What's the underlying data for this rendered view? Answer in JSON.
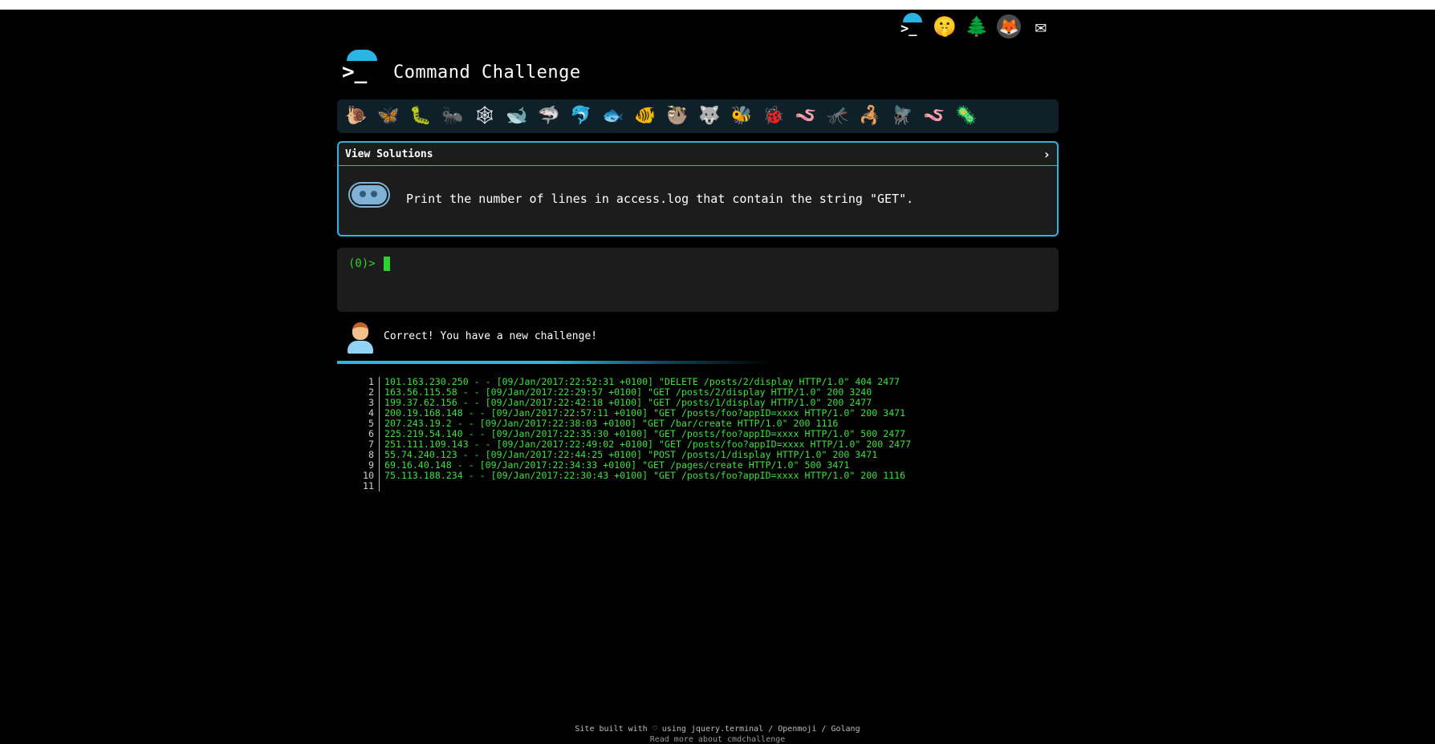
{
  "app": {
    "title": "Command Challenge",
    "top_icons": [
      "terminal-icon",
      "thinking-face-icon",
      "tree-icon",
      "gitlab-icon",
      "envelope-icon"
    ]
  },
  "critters": [
    {
      "name": "snail",
      "glyph": "🐌"
    },
    {
      "name": "butterfly",
      "glyph": "🦋"
    },
    {
      "name": "caterpillar",
      "glyph": "🐛"
    },
    {
      "name": "ant",
      "glyph": "🐜"
    },
    {
      "name": "spider-web",
      "glyph": "🕸"
    },
    {
      "name": "whale",
      "glyph": "🐋"
    },
    {
      "name": "shark",
      "glyph": "🦈"
    },
    {
      "name": "dolphin",
      "glyph": "🐬"
    },
    {
      "name": "fish",
      "glyph": "🐟"
    },
    {
      "name": "tropical-fish",
      "glyph": "🐠"
    },
    {
      "name": "sloth",
      "glyph": "🦥"
    },
    {
      "name": "wolf",
      "glyph": "🐺"
    },
    {
      "name": "bee",
      "glyph": "🐝"
    },
    {
      "name": "ladybug",
      "glyph": "🐞"
    },
    {
      "name": "worm",
      "glyph": "🪱"
    },
    {
      "name": "mosquito",
      "glyph": "🦟"
    },
    {
      "name": "scorpion",
      "glyph": "🦂"
    },
    {
      "name": "fly",
      "glyph": "🪰"
    },
    {
      "name": "worm-pink",
      "glyph": "🪱"
    },
    {
      "name": "microbe",
      "glyph": "🦠"
    }
  ],
  "challenge": {
    "header": "View Solutions",
    "chevron": "›",
    "description": "Print the number of lines in access.log that contain the string \"GET\"."
  },
  "terminal": {
    "prompt": "(0)>"
  },
  "feedback": {
    "message": "Correct! You have a new challenge!"
  },
  "log": [
    {
      "n": "1",
      "text": "101.163.230.250 - - [09/Jan/2017:22:52:31 +0100] \"DELETE /posts/2/display HTTP/1.0\" 404 2477"
    },
    {
      "n": "2",
      "text": "163.56.115.58 - - [09/Jan/2017:22:29:57 +0100] \"GET /posts/2/display HTTP/1.0\" 200 3240"
    },
    {
      "n": "3",
      "text": "199.37.62.156 - - [09/Jan/2017:22:42:18 +0100] \"GET /posts/1/display HTTP/1.0\" 200 2477"
    },
    {
      "n": "4",
      "text": "200.19.168.148 - - [09/Jan/2017:22:57:11 +0100] \"GET /posts/foo?appID=xxxx HTTP/1.0\" 200 3471"
    },
    {
      "n": "5",
      "text": "207.243.19.2 - - [09/Jan/2017:22:38:03 +0100] \"GET /bar/create HTTP/1.0\" 200 1116"
    },
    {
      "n": "6",
      "text": "225.219.54.140 - - [09/Jan/2017:22:35:30 +0100] \"GET /posts/foo?appID=xxxx HTTP/1.0\" 500 2477"
    },
    {
      "n": "7",
      "text": "251.111.109.143 - - [09/Jan/2017:22:49:02 +0100] \"GET /posts/foo?appID=xxxx HTTP/1.0\" 200 2477"
    },
    {
      "n": "8",
      "text": "55.74.240.123 - - [09/Jan/2017:22:44:25 +0100] \"POST /posts/1/display HTTP/1.0\" 200 3471"
    },
    {
      "n": "9",
      "text": "69.16.40.148 - - [09/Jan/2017:22:34:33 +0100] \"GET /pages/create HTTP/1.0\" 500 3471"
    },
    {
      "n": "10",
      "text": "75.113.188.234 - - [09/Jan/2017:22:30:43 +0100] \"GET /posts/foo?appID=xxxx HTTP/1.0\" 200 1116"
    },
    {
      "n": "11",
      "text": ""
    }
  ],
  "footer": {
    "line1": "Site built with ♡ using jquery.terminal / Openmoji / Golang",
    "line2": "Read more about cmdchallenge"
  },
  "colors": {
    "accent": "#29b6e6",
    "terminal_green": "#2ed12e",
    "panel": "#1c1c1c"
  }
}
